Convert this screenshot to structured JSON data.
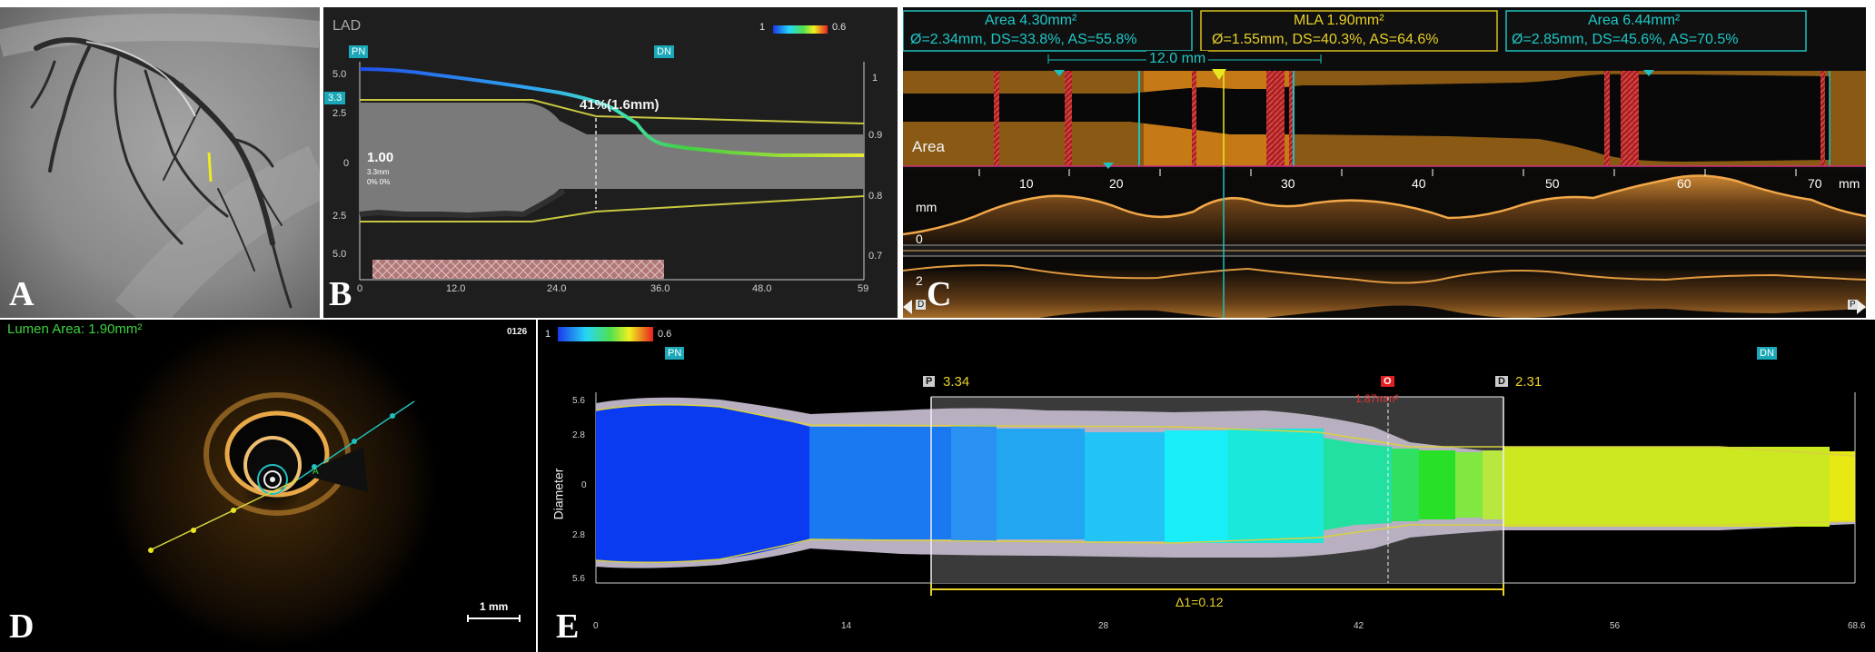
{
  "panelA": {
    "letter": "A"
  },
  "panelB": {
    "letter": "B",
    "vessel": "LAD",
    "colorbar": {
      "min": "1",
      "max": "0.6"
    },
    "pn": "PN",
    "dn": "DN",
    "left_ticks": [
      "5.0",
      "2.5",
      "0",
      "2.5",
      "5.0"
    ],
    "badge": "3.3",
    "right_ticks": [
      "1",
      "0.9",
      "0.8",
      "0.7"
    ],
    "x_ticks": [
      "0",
      "12.0",
      "24.0",
      "36.0",
      "48.0",
      "59"
    ],
    "stenosis_label": "41%(1.6mm)",
    "ffr_value": "1.00",
    "ffr_sub1": "3.3mm",
    "ffr_sub2": "0% 0%"
  },
  "panelC": {
    "letter": "C",
    "box1_line1": "Area 4.30mm²",
    "box1_line2": "Ø=2.34mm, DS=33.8%, AS=55.8%",
    "box2_line1": "MLA 1.90mm²",
    "box2_line2": "Ø=1.55mm, DS=40.3%, AS=64.6%",
    "box3_line1": "Area 6.44mm²",
    "box3_line2": "Ø=2.85mm, DS=45.6%, AS=70.5%",
    "length": "12.0 mm",
    "area_label": "Area",
    "mm_ticks": [
      "10",
      "20",
      "30",
      "40",
      "50",
      "60",
      "70"
    ],
    "mm_unit": "mm",
    "y_unit": "mm",
    "y_zero": "0",
    "y_two": "2",
    "d_marker": "D",
    "p_marker": "P"
  },
  "panelD": {
    "letter": "D",
    "lumen_area": "Lumen Area: 1.90mm²",
    "frame": "0126",
    "scale": "1 mm",
    "marker_a": "A"
  },
  "panelE": {
    "letter": "E",
    "colorbar": {
      "min": "1",
      "max": "0.6"
    },
    "pn": "PN",
    "dn": "DN",
    "p_label": "P",
    "p_value": "3.34",
    "d_label": "D",
    "d_value": "2.31",
    "o_label": "O",
    "o_value": "1.87mm²",
    "ylabel": "Diameter",
    "y_ticks": [
      "5.6",
      "2.8",
      "0",
      "2.8",
      "5.6"
    ],
    "x_ticks": [
      "0",
      "14",
      "28",
      "42",
      "56",
      "68.6"
    ],
    "delta": "Δ1=0.12"
  }
}
